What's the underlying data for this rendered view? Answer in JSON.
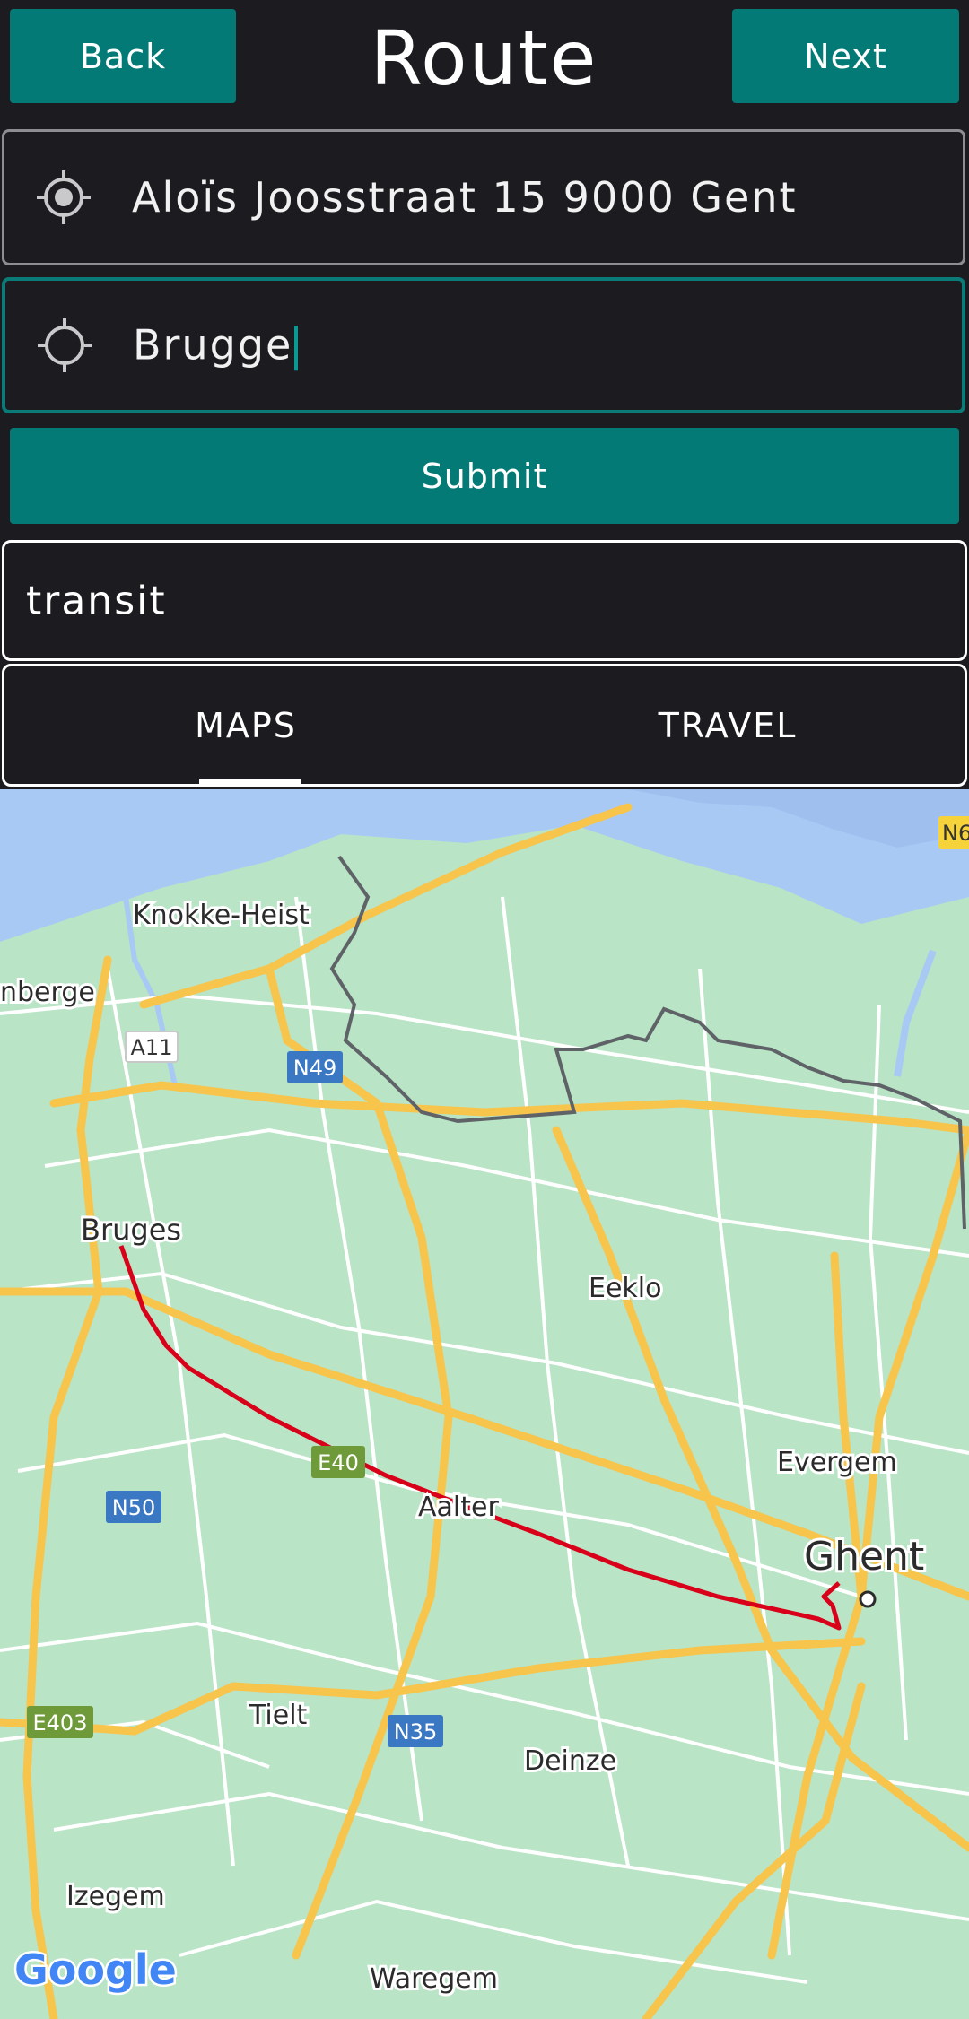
{
  "header": {
    "back_label": "Back",
    "title": "Route",
    "next_label": "Next"
  },
  "route": {
    "origin": {
      "value": "Aloïs Joosstraat 15 9000 Gent",
      "icon": "my-location-icon"
    },
    "destination": {
      "value": "Brugge",
      "icon": "location-target-icon"
    },
    "submit_label": "Submit",
    "mode_value": "transit"
  },
  "tabs": {
    "items": [
      {
        "label": "MAPS",
        "selected": true
      },
      {
        "label": "TRAVEL",
        "selected": false
      }
    ]
  },
  "map": {
    "provider_logo": "Google",
    "places": {
      "knokke": "Knokke-Heist",
      "blankenberge": "nberge",
      "bruges": "Bruges",
      "eeklo": "Eeklo",
      "evergem": "Evergem",
      "aalter": "Aalter",
      "ghent": "Ghent",
      "tielt": "Tielt",
      "deinze": "Deinze",
      "izegem": "Izegem",
      "waregem": "Waregem"
    },
    "road_shields": {
      "a11": "A11",
      "n49": "N49",
      "e40": "E40",
      "n50": "N50",
      "n35": "N35",
      "e403": "E403",
      "n6": "N6"
    },
    "colors": {
      "land": "#b9e4c6",
      "water": "#a9c9f5",
      "major_road": "#f7c44c",
      "route_line": "#d9001a",
      "border": "#5f6368",
      "shield_blue": "#3b78c4",
      "shield_green": "#6f9a3a",
      "shield_yellow": "#f6d33a"
    }
  },
  "colors": {
    "background": "#1b1b20",
    "accent": "#047a76"
  }
}
